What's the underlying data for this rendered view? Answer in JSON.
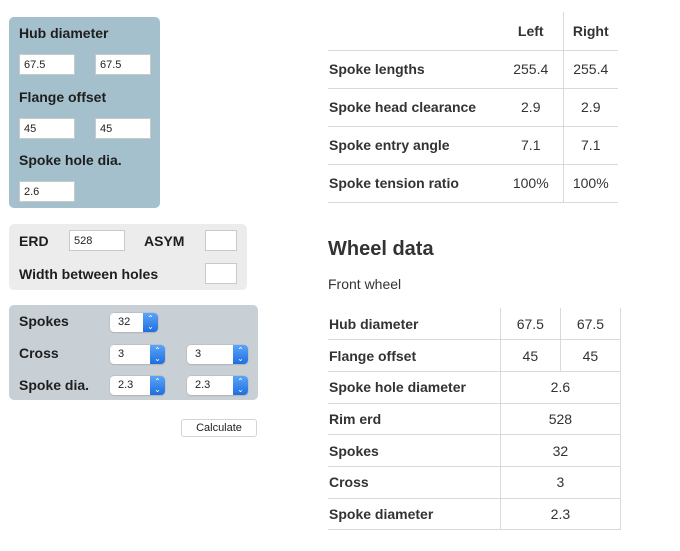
{
  "hub_panel": {
    "hub_diameter_label": "Hub diameter",
    "hub_diameter_left": "67.5",
    "hub_diameter_right": "67.5",
    "flange_offset_label": "Flange offset",
    "flange_offset_left": "45",
    "flange_offset_right": "45",
    "spoke_hole_label": "Spoke hole dia.",
    "spoke_hole_value": "2.6"
  },
  "rim_panel": {
    "erd_label": "ERD",
    "erd_value": "528",
    "asym_label": "ASYM",
    "asym_value": "",
    "width_label": "Width between holes",
    "width_value": ""
  },
  "spoke_panel": {
    "spokes_label": "Spokes",
    "spokes_value": "32",
    "cross_label": "Cross",
    "cross_left": "3",
    "cross_right": "3",
    "spoke_dia_label": "Spoke dia.",
    "spoke_dia_left": "2.3",
    "spoke_dia_right": "2.3"
  },
  "calculate_label": "Calculate",
  "results": {
    "headers": [
      "",
      "Left",
      "Right"
    ],
    "rows": [
      {
        "label": "Spoke lengths",
        "left": "255.4",
        "right": "255.4"
      },
      {
        "label": "Spoke head clearance",
        "left": "2.9",
        "right": "2.9"
      },
      {
        "label": "Spoke entry angle",
        "left": "7.1",
        "right": "7.1"
      },
      {
        "label": "Spoke tension ratio",
        "left": "100%",
        "right": "100%"
      }
    ]
  },
  "wheel_data": {
    "title": "Wheel data",
    "subtitle": "Front wheel",
    "rows": [
      {
        "label": "Hub diameter",
        "left": "67.5",
        "right": "67.5"
      },
      {
        "label": "Flange offset",
        "left": "45",
        "right": "45"
      },
      {
        "label": "Spoke hole diameter",
        "value": "2.6"
      },
      {
        "label": "Rim erd",
        "value": "528"
      },
      {
        "label": "Spokes",
        "value": "32"
      },
      {
        "label": "Cross",
        "value": "3"
      },
      {
        "label": "Spoke diameter",
        "value": "2.3"
      }
    ]
  },
  "colors": {
    "hub_panel_bg": "#a3c0cc",
    "rim_panel_bg": "#ececec",
    "spoke_panel_bg": "#c8d0d6",
    "select_accent": "#2f80ed"
  }
}
